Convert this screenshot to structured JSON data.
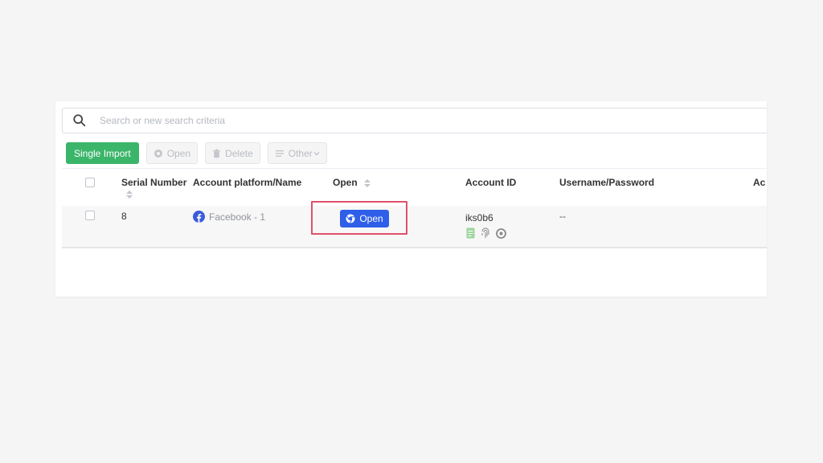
{
  "search": {
    "placeholder": "Search or new search criteria",
    "icon": "search-icon"
  },
  "toolbar": {
    "single_import": "Single Import",
    "open": "Open",
    "delete": "Delete",
    "other": "Other"
  },
  "table": {
    "headers": {
      "serial": "Serial Number",
      "platform": "Account platform/Name",
      "open": "Open",
      "account_id": "Account ID",
      "username_password": "Username/Password",
      "truncated": "Ac"
    },
    "rows": [
      {
        "serial": "8",
        "platform_icon": "facebook-icon",
        "platform": "Facebook - 1",
        "open_label": "Open",
        "account_id": "iks0b6",
        "username_password": "--"
      }
    ]
  },
  "colors": {
    "primary_green": "#3bb56a",
    "open_blue": "#2f5ee9",
    "highlight_red": "#e0506a",
    "facebook_blue": "#3b5bdb"
  }
}
